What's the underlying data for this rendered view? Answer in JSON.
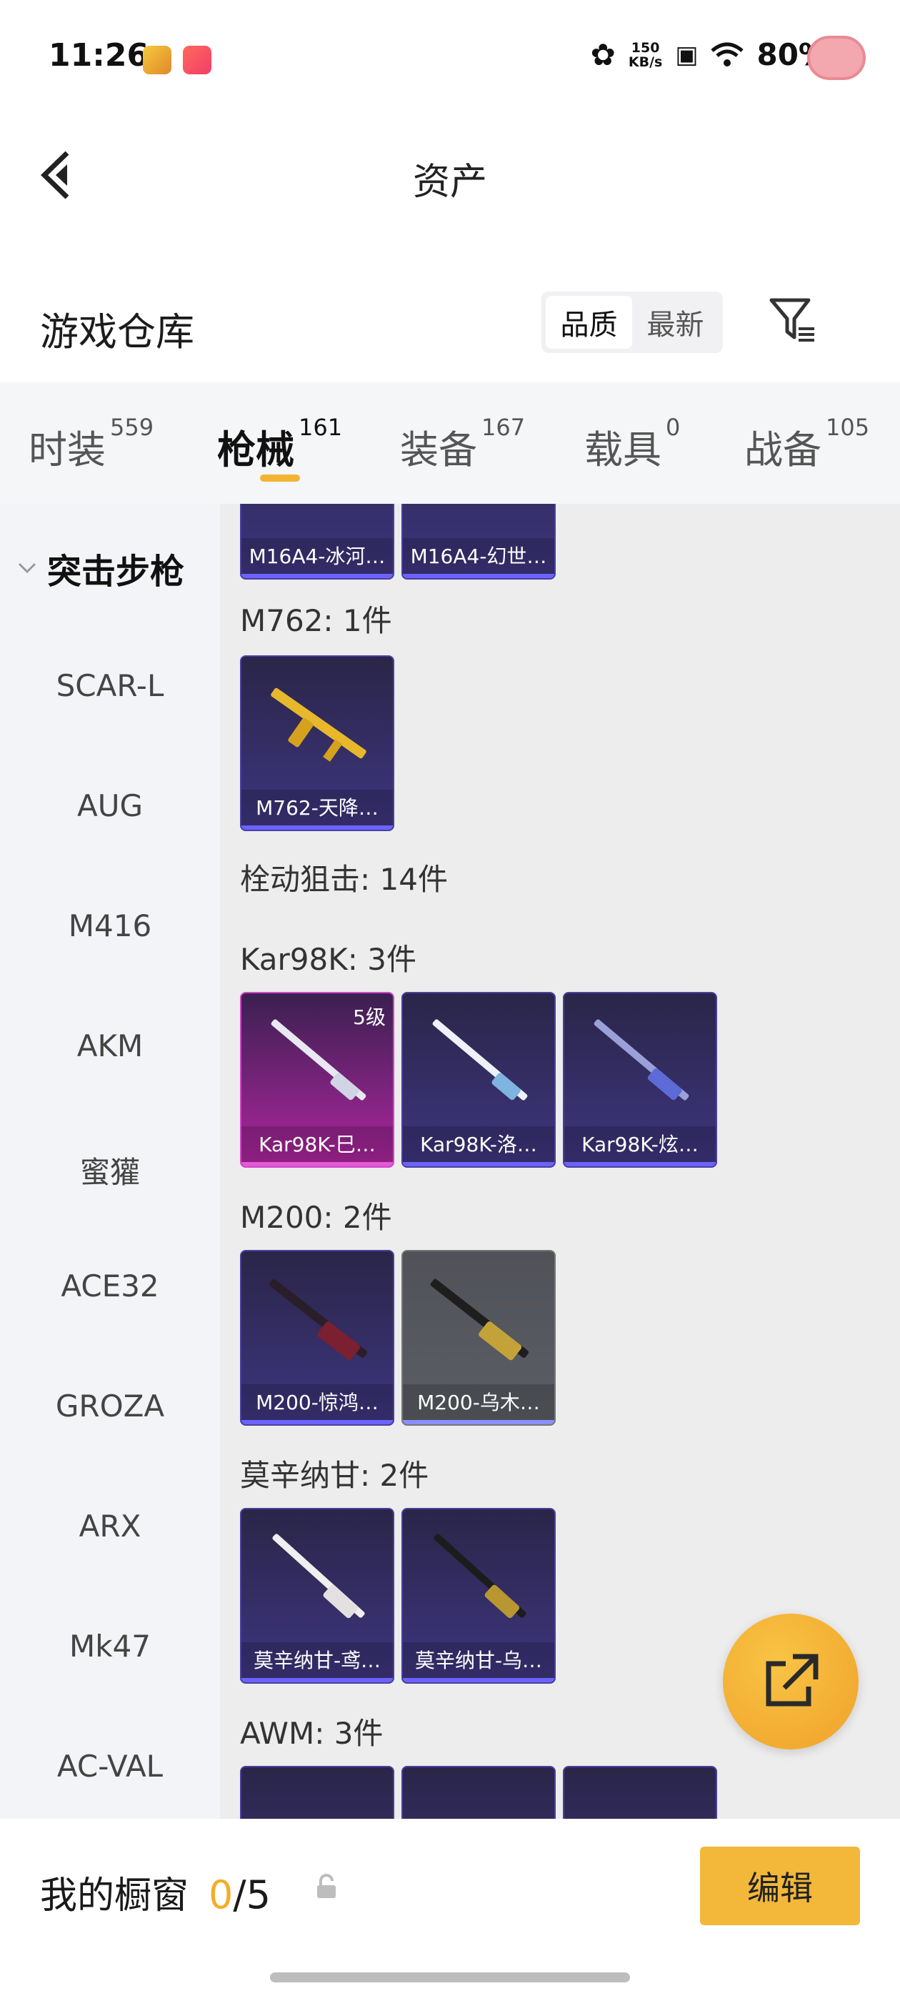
{
  "status_bar": {
    "time": "11:26",
    "speed_value": "150",
    "speed_unit": "KB/s",
    "battery": "80%"
  },
  "header": {
    "title": "资产"
  },
  "section": {
    "title": "游戏仓库",
    "sort_options": [
      "品质",
      "最新"
    ],
    "selected_sort": "品质"
  },
  "tabs": [
    {
      "label": "时装",
      "count": "559"
    },
    {
      "label": "枪械",
      "count": "161"
    },
    {
      "label": "装备",
      "count": "167"
    },
    {
      "label": "载具",
      "count": "0"
    },
    {
      "label": "战备",
      "count": "105"
    }
  ],
  "active_tab": "枪械",
  "side_menu": {
    "header": "突击步枪",
    "items": [
      "SCAR-L",
      "AUG",
      "M416",
      "AKM",
      "蜜獾",
      "ACE32",
      "GROZA",
      "ARX",
      "Mk47",
      "AC-VAL"
    ]
  },
  "content": {
    "top_cards": [
      "M16A4-冰河…",
      "M16A4-幻世…"
    ],
    "m762_header": "M762: 1件",
    "m762_cards": [
      "M762-天降…"
    ],
    "bolt_header": "栓动狙击: 14件",
    "kar_header": "Kar98K: 3件",
    "kar_cards": [
      "Kar98K-巳…",
      "Kar98K-洛…",
      "Kar98K-炫…"
    ],
    "kar_level": "5级",
    "m200_header": "M200: 2件",
    "m200_cards": [
      "M200-惊鸿…",
      "M200-乌木…"
    ],
    "mosin_header": "莫辛纳甘: 2件",
    "mosin_cards": [
      "莫辛纳甘-鸢…",
      "莫辛纳甘-乌…"
    ],
    "awm_header": "AWM: 3件"
  },
  "bottom": {
    "showcase_label": "我的橱窗",
    "showcase_current": "0",
    "showcase_total": "/5",
    "edit_label": "编辑"
  },
  "colors": {
    "accent": "#f3b433",
    "card_purple": "#3e3680",
    "card_red": "#b0269f"
  }
}
